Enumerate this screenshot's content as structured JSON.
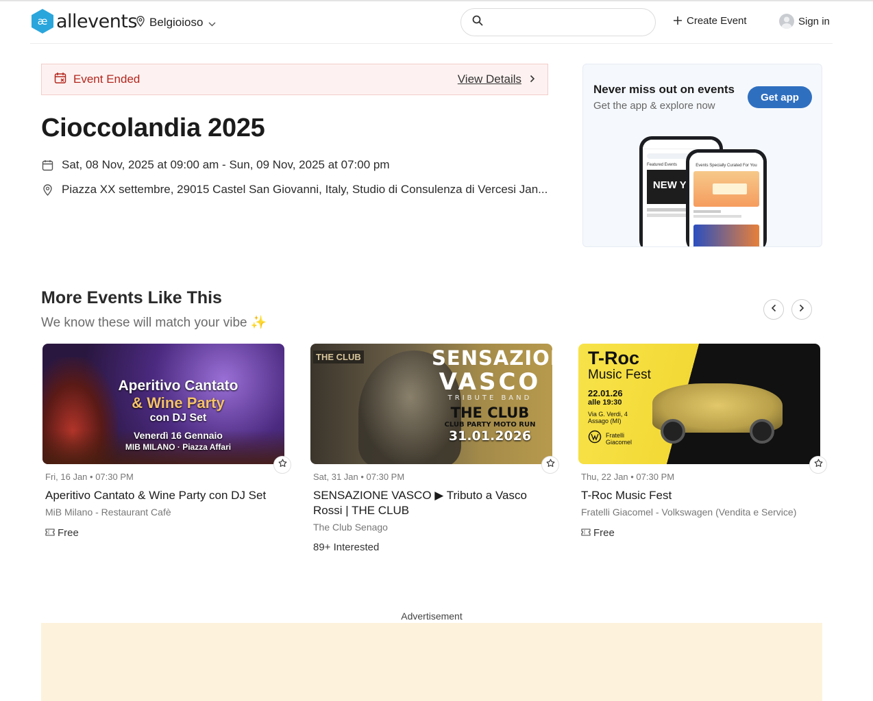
{
  "header": {
    "logo_text": "allevents",
    "location": "Belgioioso",
    "search_placeholder": "",
    "create_label": "Create Event",
    "signin_label": "Sign in"
  },
  "event": {
    "status": "Event Ended",
    "view_details": "View Details",
    "title": "Cioccolandia 2025",
    "datetime": "Sat, 08 Nov, 2025 at 09:00 am - Sun, 09 Nov, 2025 at 07:00 pm",
    "location": "Piazza XX settembre, 29015 Castel San Giovanni, Italy, Studio di Consulenza di Vercesi Jan..."
  },
  "promo": {
    "title": "Never miss out on events",
    "subtitle": "Get the app & explore now",
    "button": "Get app"
  },
  "more": {
    "title": "More Events Like This",
    "subtitle": "We know these will match your vibe ✨",
    "cards": [
      {
        "date": "Fri, 16 Jan • 07:30 PM",
        "name": "Aperitivo Cantato & Wine Party con DJ Set",
        "venue": "MiB Milano - Restaurant Cafè",
        "price": "Free",
        "img_line1": "Aperitivo Cantato",
        "img_line2": "& Wine Party",
        "img_line3": "con DJ Set",
        "img_line4": "Venerdì 16 Gennaio",
        "img_line5": "MIB MILANO · Piazza Affari"
      },
      {
        "date": "Sat, 31 Jan • 07:30 PM",
        "name": "SENSAZIONE VASCO ▶ Tributo a Vasco Rossi | THE CLUB",
        "venue": "The Club Senago",
        "interest": "89+ Interested",
        "img_tag": "THE CLUB",
        "img_line1": "SENSAZIONE",
        "img_line2": "VASCO",
        "img_line3": "TRIBUTE BAND",
        "img_line4": "THE CLUB",
        "img_line5": "CLUB PARTY MOTO RUN",
        "img_line6": "31.01.2026"
      },
      {
        "date": "Thu, 22 Jan • 07:30 PM",
        "name": "T-Roc Music Fest",
        "venue": "Fratelli Giacomel - Volkswagen (Vendita e Service)",
        "price": "Free",
        "img_line1": "T-Roc",
        "img_line2": "Music Fest",
        "img_line3": "22.01.26",
        "img_line4": "alle 19:30",
        "img_line5": "Via G. Verdi, 4",
        "img_line6": "Assago (MI)",
        "img_line7": "Fratelli",
        "img_line8": "Giacomel"
      }
    ]
  },
  "ad_label": "Advertisement",
  "colors": {
    "brand_blue": "#2f6fc0",
    "ended_red": "#b3261e",
    "ad_bg": "#fdf3dc"
  }
}
